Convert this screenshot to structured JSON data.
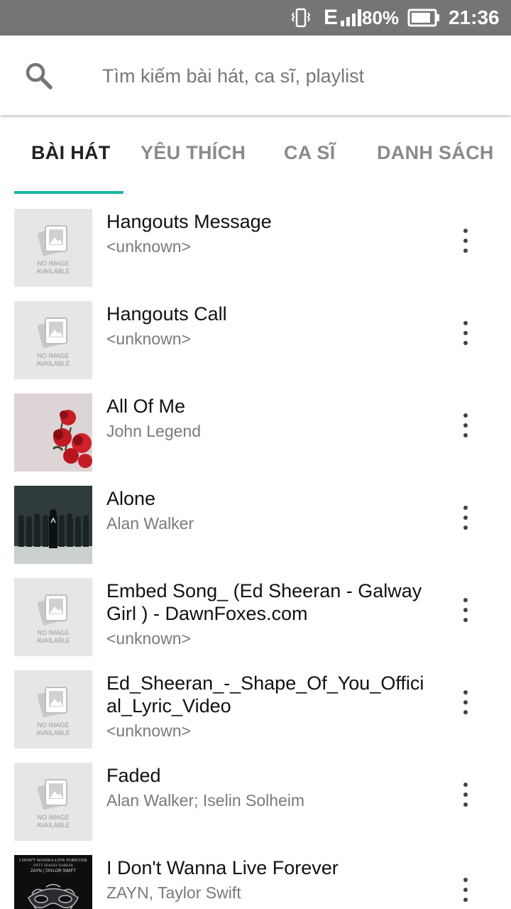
{
  "status_bar": {
    "network": "E",
    "battery_percent": "80%",
    "time": "21:36"
  },
  "search": {
    "placeholder": "Tìm kiếm bài hát, ca sĩ, playlist"
  },
  "tabs": [
    {
      "label": "BÀI HÁT",
      "active": true
    },
    {
      "label": "YÊU THÍCH",
      "active": false
    },
    {
      "label": "CA SĨ",
      "active": false
    },
    {
      "label": "DANH SÁCH",
      "active": false
    }
  ],
  "placeholder_art": {
    "line1": "NO IMAGE",
    "line2": "AVAILABLE"
  },
  "songs": [
    {
      "title": "Hangouts Message",
      "artist": "<unknown>",
      "art": "none"
    },
    {
      "title": "Hangouts Call",
      "artist": "<unknown>",
      "art": "none"
    },
    {
      "title": "All Of Me",
      "artist": "John Legend",
      "art": "roses"
    },
    {
      "title": "Alone",
      "artist": "Alan Walker",
      "art": "crowd"
    },
    {
      "title": "Embed Song_ (Ed Sheeran - Galway Girl ) - DawnFoxes.com",
      "artist": "<unknown>",
      "art": "none"
    },
    {
      "title": "Ed_Sheeran_-_Shape_Of_You_Official_Lyric_Video",
      "artist": "<unknown>",
      "art": "none"
    },
    {
      "title": "Faded",
      "artist": "Alan Walker; Iselin Solheim",
      "art": "none"
    },
    {
      "title": "I Don't Wanna Live Forever",
      "artist": "ZAYN, Taylor Swift",
      "art": "mask",
      "art_text": {
        "line1": "I DON'T WANNA LIVE FOREVER",
        "line2": "FIFTY SHADES DARKER",
        "line3": "ZAYN | TAYLOR SWIFT"
      }
    }
  ],
  "colors": {
    "status_bar": "#757575",
    "accent": "#1ab7a2",
    "placeholder_bg": "#e6e6e6"
  }
}
